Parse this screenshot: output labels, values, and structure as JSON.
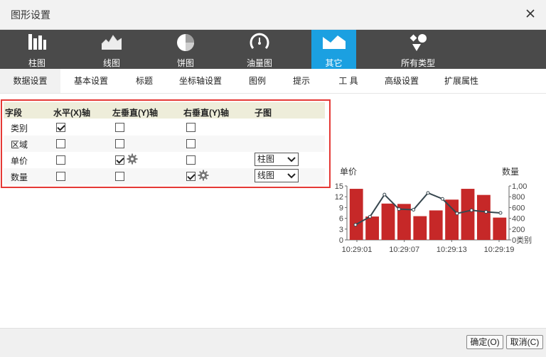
{
  "dialog": {
    "title": "图形设置"
  },
  "types": [
    {
      "label": "柱图",
      "icon": "bar-chart-icon",
      "active": false
    },
    {
      "label": "线图",
      "icon": "line-chart-icon",
      "active": false
    },
    {
      "label": "饼图",
      "icon": "pie-chart-icon",
      "active": false
    },
    {
      "label": "油量图",
      "icon": "gauge-icon",
      "active": false
    },
    {
      "label": "其它",
      "icon": "area-chart-icon",
      "active": true
    },
    {
      "label": "所有类型",
      "icon": "shapes-icon",
      "active": false
    }
  ],
  "tabs": [
    {
      "label": "数据设置",
      "active": true
    },
    {
      "label": "基本设置"
    },
    {
      "label": "标题"
    },
    {
      "label": "坐标轴设置"
    },
    {
      "label": "图例"
    },
    {
      "label": "提示"
    },
    {
      "label": "工 具"
    },
    {
      "label": "高级设置"
    },
    {
      "label": "扩展属性"
    }
  ],
  "grid": {
    "headers": {
      "field": "字段",
      "x_axis": "水平(X)轴",
      "left_y": "左垂直(Y)轴",
      "right_y": "右垂直(Y)轴",
      "subchart": "子图"
    },
    "rows": [
      {
        "label": "类别",
        "x": true,
        "left": false,
        "right": false,
        "gear_left": false,
        "gear_right": false,
        "subchart": ""
      },
      {
        "label": "区域",
        "x": false,
        "left": false,
        "right": false,
        "gear_left": false,
        "gear_right": false,
        "subchart": ""
      },
      {
        "label": "单价",
        "x": false,
        "left": true,
        "right": false,
        "gear_left": true,
        "gear_right": false,
        "subchart": "柱图"
      },
      {
        "label": "数量",
        "x": false,
        "left": false,
        "right": true,
        "gear_left": false,
        "gear_right": true,
        "subchart": "线图"
      }
    ]
  },
  "chart_data": {
    "type": "bar",
    "left_axis_label": "单价",
    "right_axis_label": "数量",
    "x_tick_labels": [
      "10:29:01",
      "10:29:07",
      "10:29:13",
      "10:29:19"
    ],
    "left_y_ticks": [
      "0",
      "3",
      "6",
      "9",
      "12",
      "15"
    ],
    "right_y_ticks": [
      "0类别",
      "200",
      "400",
      "600",
      "800",
      "1,00"
    ],
    "left_ylim": [
      0,
      15
    ],
    "right_ylim": [
      0,
      1000
    ],
    "bar_color": "#c62828",
    "line_color": "#37474f",
    "series": [
      {
        "values": [
          14.2,
          6.5,
          10.1,
          10.0,
          6.6,
          8.2,
          11.2,
          14.2,
          12.5,
          6.2
        ]
      },
      {
        "values": [
          280,
          430,
          840,
          570,
          560,
          870,
          760,
          490,
          550,
          520,
          500
        ]
      }
    ]
  },
  "buttons": {
    "ok": "确定(O)",
    "cancel": "取消(C)"
  }
}
